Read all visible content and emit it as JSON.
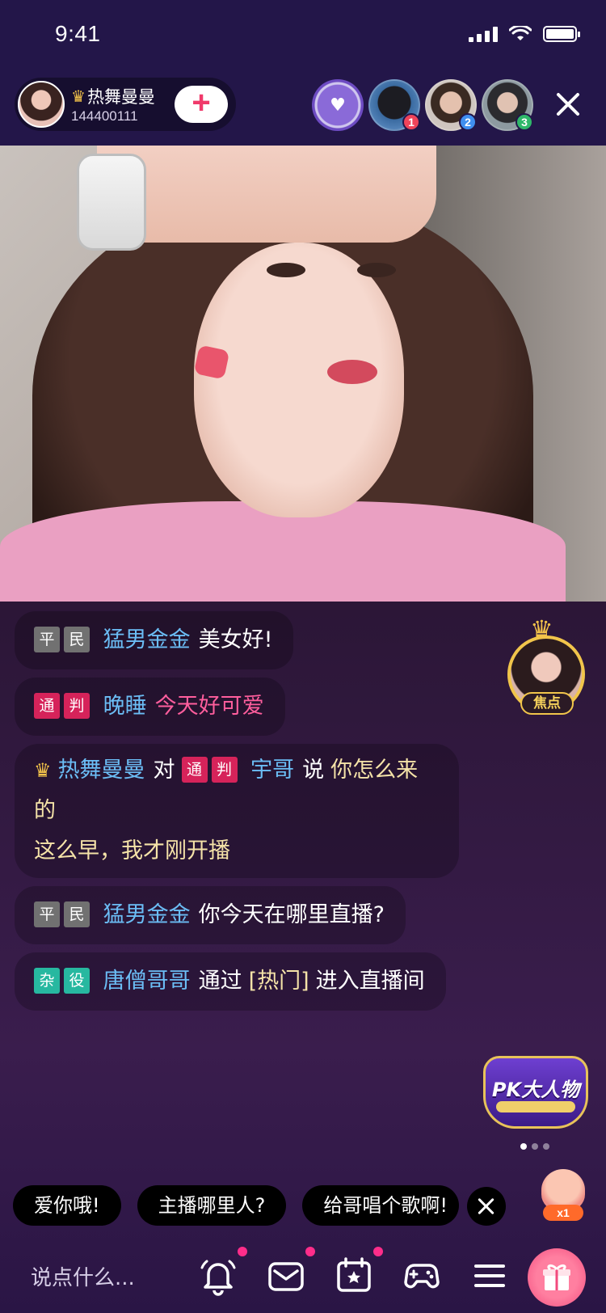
{
  "status": {
    "time": "9:41"
  },
  "host": {
    "name": "热舞曼曼",
    "id": "144400111",
    "follow_label": "+"
  },
  "viewers": [
    {
      "rank": "1",
      "rank_color": "#f0445a"
    },
    {
      "rank": "2",
      "rank_color": "#3f8ff0"
    },
    {
      "rank": "3",
      "rank_color": "#2fb86a"
    }
  ],
  "chat": [
    {
      "tags": [
        "平",
        "民"
      ],
      "tag_style": "grey",
      "user": "猛男金金",
      "text": "美女好!",
      "text_style": "white"
    },
    {
      "tags": [
        "通",
        "判"
      ],
      "tag_style": "red",
      "user": "晚睡",
      "text": "今天好可爱",
      "text_style": "pink"
    },
    {
      "from": "热舞曼曼",
      "connector": "对",
      "tags": [
        "通",
        "判"
      ],
      "tag_style": "red",
      "user": "宇哥",
      "verb": "说",
      "text_part1": "你怎么来的",
      "text_part2": "这么早，我才刚开播"
    },
    {
      "tags": [
        "平",
        "民"
      ],
      "tag_style": "grey",
      "user": "猛男金金",
      "text": "你今天在哪里直播?",
      "text_style": "white"
    },
    {
      "tags": [
        "杂",
        "役"
      ],
      "tag_style": "teal",
      "user": "唐僧哥哥",
      "text_prefix": "通过",
      "highlight": "[热门]",
      "text_suffix": "进入直播间"
    }
  ],
  "focus_badge": {
    "label": "焦点"
  },
  "pk_badge": {
    "label": "PK大人物"
  },
  "quick_replies": [
    "爱你哦!",
    "主播哪里人?",
    "给哥唱个歌啊!"
  ],
  "clap": {
    "count": "x1"
  },
  "bottom": {
    "input_placeholder": "说点什么...",
    "icons": [
      "bell-icon",
      "mail-icon",
      "calendar-icon",
      "gamepad-icon",
      "menu-icon",
      "gift-icon"
    ]
  },
  "colors": {
    "accent_pink": "#ff5e9d",
    "username_blue": "#6bbdf5",
    "gold": "#f4c34a",
    "top_bg": "#231649"
  }
}
